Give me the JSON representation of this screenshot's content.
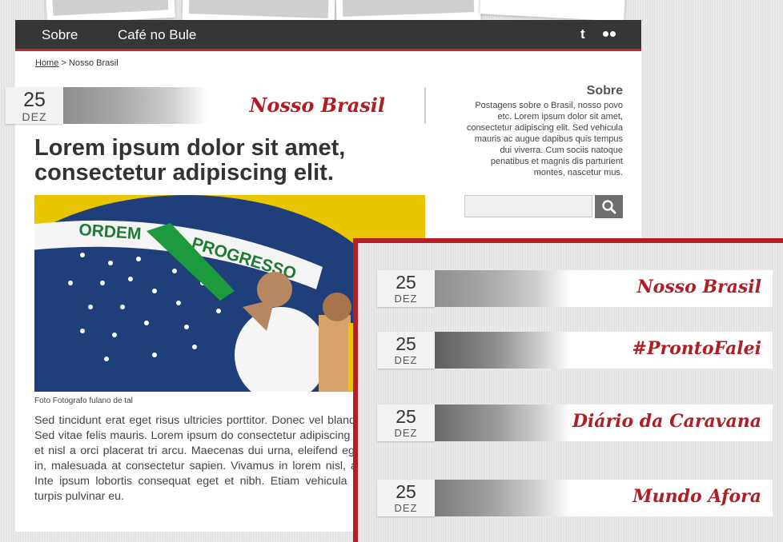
{
  "nav": {
    "items": [
      "Sobre",
      "Café no Bule"
    ],
    "icons": [
      "twitter-icon",
      "flickr-icon"
    ],
    "twitter_glyph": "t"
  },
  "breadcrumb": {
    "home": "Home",
    "separator": ">",
    "current": "Nosso Brasil"
  },
  "post": {
    "day": "25",
    "month": "DEZ",
    "category": "Nosso Brasil",
    "headline": "Lorem ipsum dolor sit amet, consectetur adipiscing elit.",
    "caption": "Foto Fotografo fulano de tal",
    "body": "Sed tincidunt erat eget risus ultricies porttitor. Donec vel blandit molestie. Sed vitae felis mauris. Lorem ipsum do consectetur adipiscing elit. Integer et nisl a orci placerat tri arcu. Maecenas dui urna, eleifend eget molestie in, malesuada at consectetur sapien. Vivamus in lorem nisl, a mollis mi. Inte ipsum lobortis consequat eget et nibh. Etiam vehicula susci porta turpis pulvinar eu."
  },
  "hero_banner_text": [
    "ORDEM",
    "PROGRESSO"
  ],
  "sidebar": {
    "title": "Sobre",
    "text": "Postagens sobre o Brasil, nosso povo etc. Lorem ipsum dolor sit amet, consectetur adipiscing elit. Sed vehicula mauris ac augue dapibus quis tempus dui viverra. Cum sociis natoque penatibus et magnis dis parturient montes, nascetur mus.",
    "search_placeholder": ""
  },
  "overlay_banners": [
    {
      "day": "25",
      "month": "DEZ",
      "title": "Nosso Brasil"
    },
    {
      "day": "25",
      "month": "DEZ",
      "title": "#ProntoFalei"
    },
    {
      "day": "25",
      "month": "DEZ",
      "title": "Diário da Caravana"
    },
    {
      "day": "25",
      "month": "DEZ",
      "title": "Mundo Afora"
    }
  ],
  "colors": {
    "accent": "#b01d24",
    "nav_bg": "#363636",
    "flag_green": "#1f8a3a",
    "flag_yellow": "#e9c500",
    "flag_blue": "#1f3f7a"
  }
}
